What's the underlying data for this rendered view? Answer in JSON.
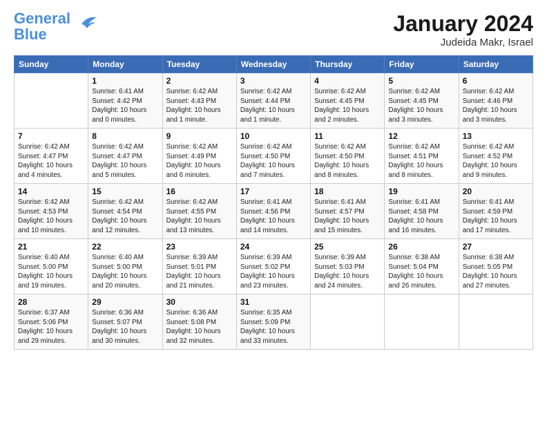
{
  "header": {
    "logo_line1": "General",
    "logo_line2": "Blue",
    "title": "January 2024",
    "subtitle": "Judeida Makr, Israel"
  },
  "calendar": {
    "days_of_week": [
      "Sunday",
      "Monday",
      "Tuesday",
      "Wednesday",
      "Thursday",
      "Friday",
      "Saturday"
    ],
    "weeks": [
      [
        {
          "num": "",
          "detail": ""
        },
        {
          "num": "1",
          "detail": "Sunrise: 6:41 AM\nSunset: 4:42 PM\nDaylight: 10 hours\nand 0 minutes."
        },
        {
          "num": "2",
          "detail": "Sunrise: 6:42 AM\nSunset: 4:43 PM\nDaylight: 10 hours\nand 1 minute."
        },
        {
          "num": "3",
          "detail": "Sunrise: 6:42 AM\nSunset: 4:44 PM\nDaylight: 10 hours\nand 1 minute."
        },
        {
          "num": "4",
          "detail": "Sunrise: 6:42 AM\nSunset: 4:45 PM\nDaylight: 10 hours\nand 2 minutes."
        },
        {
          "num": "5",
          "detail": "Sunrise: 6:42 AM\nSunset: 4:45 PM\nDaylight: 10 hours\nand 3 minutes."
        },
        {
          "num": "6",
          "detail": "Sunrise: 6:42 AM\nSunset: 4:46 PM\nDaylight: 10 hours\nand 3 minutes."
        }
      ],
      [
        {
          "num": "7",
          "detail": "Sunrise: 6:42 AM\nSunset: 4:47 PM\nDaylight: 10 hours\nand 4 minutes."
        },
        {
          "num": "8",
          "detail": "Sunrise: 6:42 AM\nSunset: 4:47 PM\nDaylight: 10 hours\nand 5 minutes."
        },
        {
          "num": "9",
          "detail": "Sunrise: 6:42 AM\nSunset: 4:49 PM\nDaylight: 10 hours\nand 6 minutes."
        },
        {
          "num": "10",
          "detail": "Sunrise: 6:42 AM\nSunset: 4:50 PM\nDaylight: 10 hours\nand 7 minutes."
        },
        {
          "num": "11",
          "detail": "Sunrise: 6:42 AM\nSunset: 4:50 PM\nDaylight: 10 hours\nand 8 minutes."
        },
        {
          "num": "12",
          "detail": "Sunrise: 6:42 AM\nSunset: 4:51 PM\nDaylight: 10 hours\nand 8 minutes."
        },
        {
          "num": "13",
          "detail": "Sunrise: 6:42 AM\nSunset: 4:52 PM\nDaylight: 10 hours\nand 9 minutes."
        }
      ],
      [
        {
          "num": "14",
          "detail": "Sunrise: 6:42 AM\nSunset: 4:53 PM\nDaylight: 10 hours\nand 10 minutes."
        },
        {
          "num": "15",
          "detail": "Sunrise: 6:42 AM\nSunset: 4:54 PM\nDaylight: 10 hours\nand 12 minutes."
        },
        {
          "num": "16",
          "detail": "Sunrise: 6:42 AM\nSunset: 4:55 PM\nDaylight: 10 hours\nand 13 minutes."
        },
        {
          "num": "17",
          "detail": "Sunrise: 6:41 AM\nSunset: 4:56 PM\nDaylight: 10 hours\nand 14 minutes."
        },
        {
          "num": "18",
          "detail": "Sunrise: 6:41 AM\nSunset: 4:57 PM\nDaylight: 10 hours\nand 15 minutes."
        },
        {
          "num": "19",
          "detail": "Sunrise: 6:41 AM\nSunset: 4:58 PM\nDaylight: 10 hours\nand 16 minutes."
        },
        {
          "num": "20",
          "detail": "Sunrise: 6:41 AM\nSunset: 4:59 PM\nDaylight: 10 hours\nand 17 minutes."
        }
      ],
      [
        {
          "num": "21",
          "detail": "Sunrise: 6:40 AM\nSunset: 5:00 PM\nDaylight: 10 hours\nand 19 minutes."
        },
        {
          "num": "22",
          "detail": "Sunrise: 6:40 AM\nSunset: 5:00 PM\nDaylight: 10 hours\nand 20 minutes."
        },
        {
          "num": "23",
          "detail": "Sunrise: 6:39 AM\nSunset: 5:01 PM\nDaylight: 10 hours\nand 21 minutes."
        },
        {
          "num": "24",
          "detail": "Sunrise: 6:39 AM\nSunset: 5:02 PM\nDaylight: 10 hours\nand 23 minutes."
        },
        {
          "num": "25",
          "detail": "Sunrise: 6:39 AM\nSunset: 5:03 PM\nDaylight: 10 hours\nand 24 minutes."
        },
        {
          "num": "26",
          "detail": "Sunrise: 6:38 AM\nSunset: 5:04 PM\nDaylight: 10 hours\nand 26 minutes."
        },
        {
          "num": "27",
          "detail": "Sunrise: 6:38 AM\nSunset: 5:05 PM\nDaylight: 10 hours\nand 27 minutes."
        }
      ],
      [
        {
          "num": "28",
          "detail": "Sunrise: 6:37 AM\nSunset: 5:06 PM\nDaylight: 10 hours\nand 29 minutes."
        },
        {
          "num": "29",
          "detail": "Sunrise: 6:36 AM\nSunset: 5:07 PM\nDaylight: 10 hours\nand 30 minutes."
        },
        {
          "num": "30",
          "detail": "Sunrise: 6:36 AM\nSunset: 5:08 PM\nDaylight: 10 hours\nand 32 minutes."
        },
        {
          "num": "31",
          "detail": "Sunrise: 6:35 AM\nSunset: 5:09 PM\nDaylight: 10 hours\nand 33 minutes."
        },
        {
          "num": "",
          "detail": ""
        },
        {
          "num": "",
          "detail": ""
        },
        {
          "num": "",
          "detail": ""
        }
      ]
    ]
  }
}
